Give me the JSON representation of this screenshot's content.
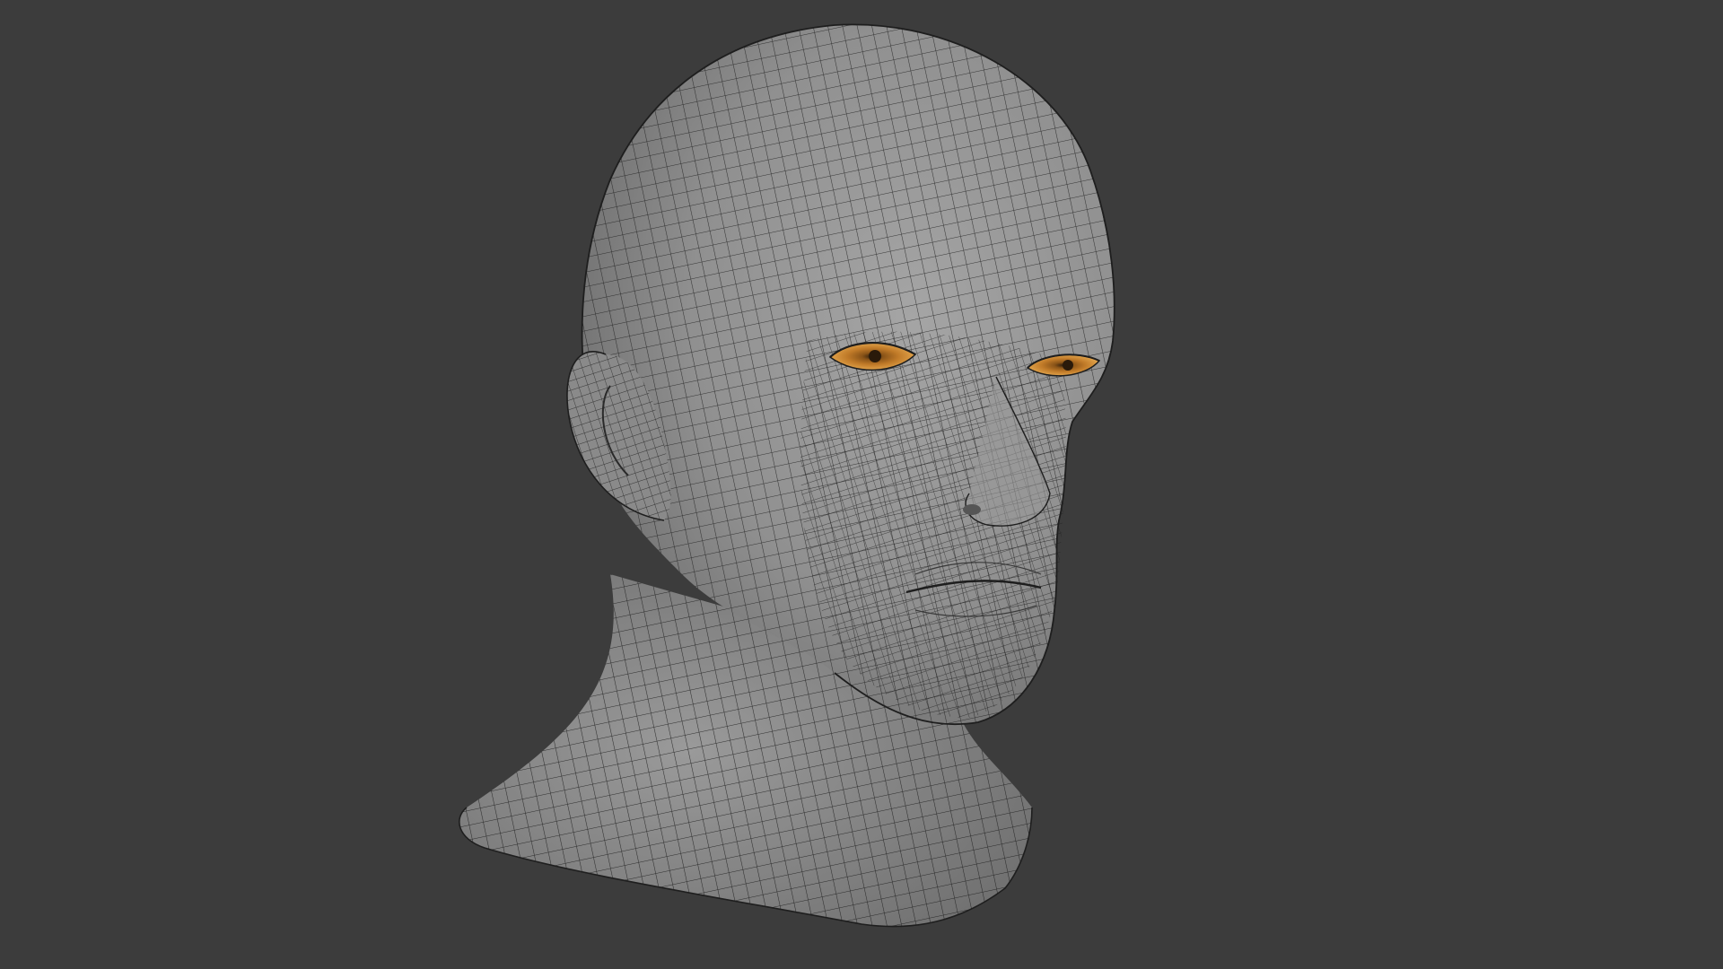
{
  "scene": {
    "subject": "head-mesh",
    "colors": {
      "background": "#3c3c3c",
      "skin": "#8e8e8e",
      "skin_light": "#a2a2a2",
      "skin_dark": "#6b6b6b",
      "wireframe": "#1e1e1e",
      "iris": "#c07a28",
      "iris_light": "#e0a24a",
      "pupil": "#2a1a0a"
    },
    "icons": [
      "head-mesh-icon",
      "eye-icon",
      "ear-icon"
    ]
  }
}
